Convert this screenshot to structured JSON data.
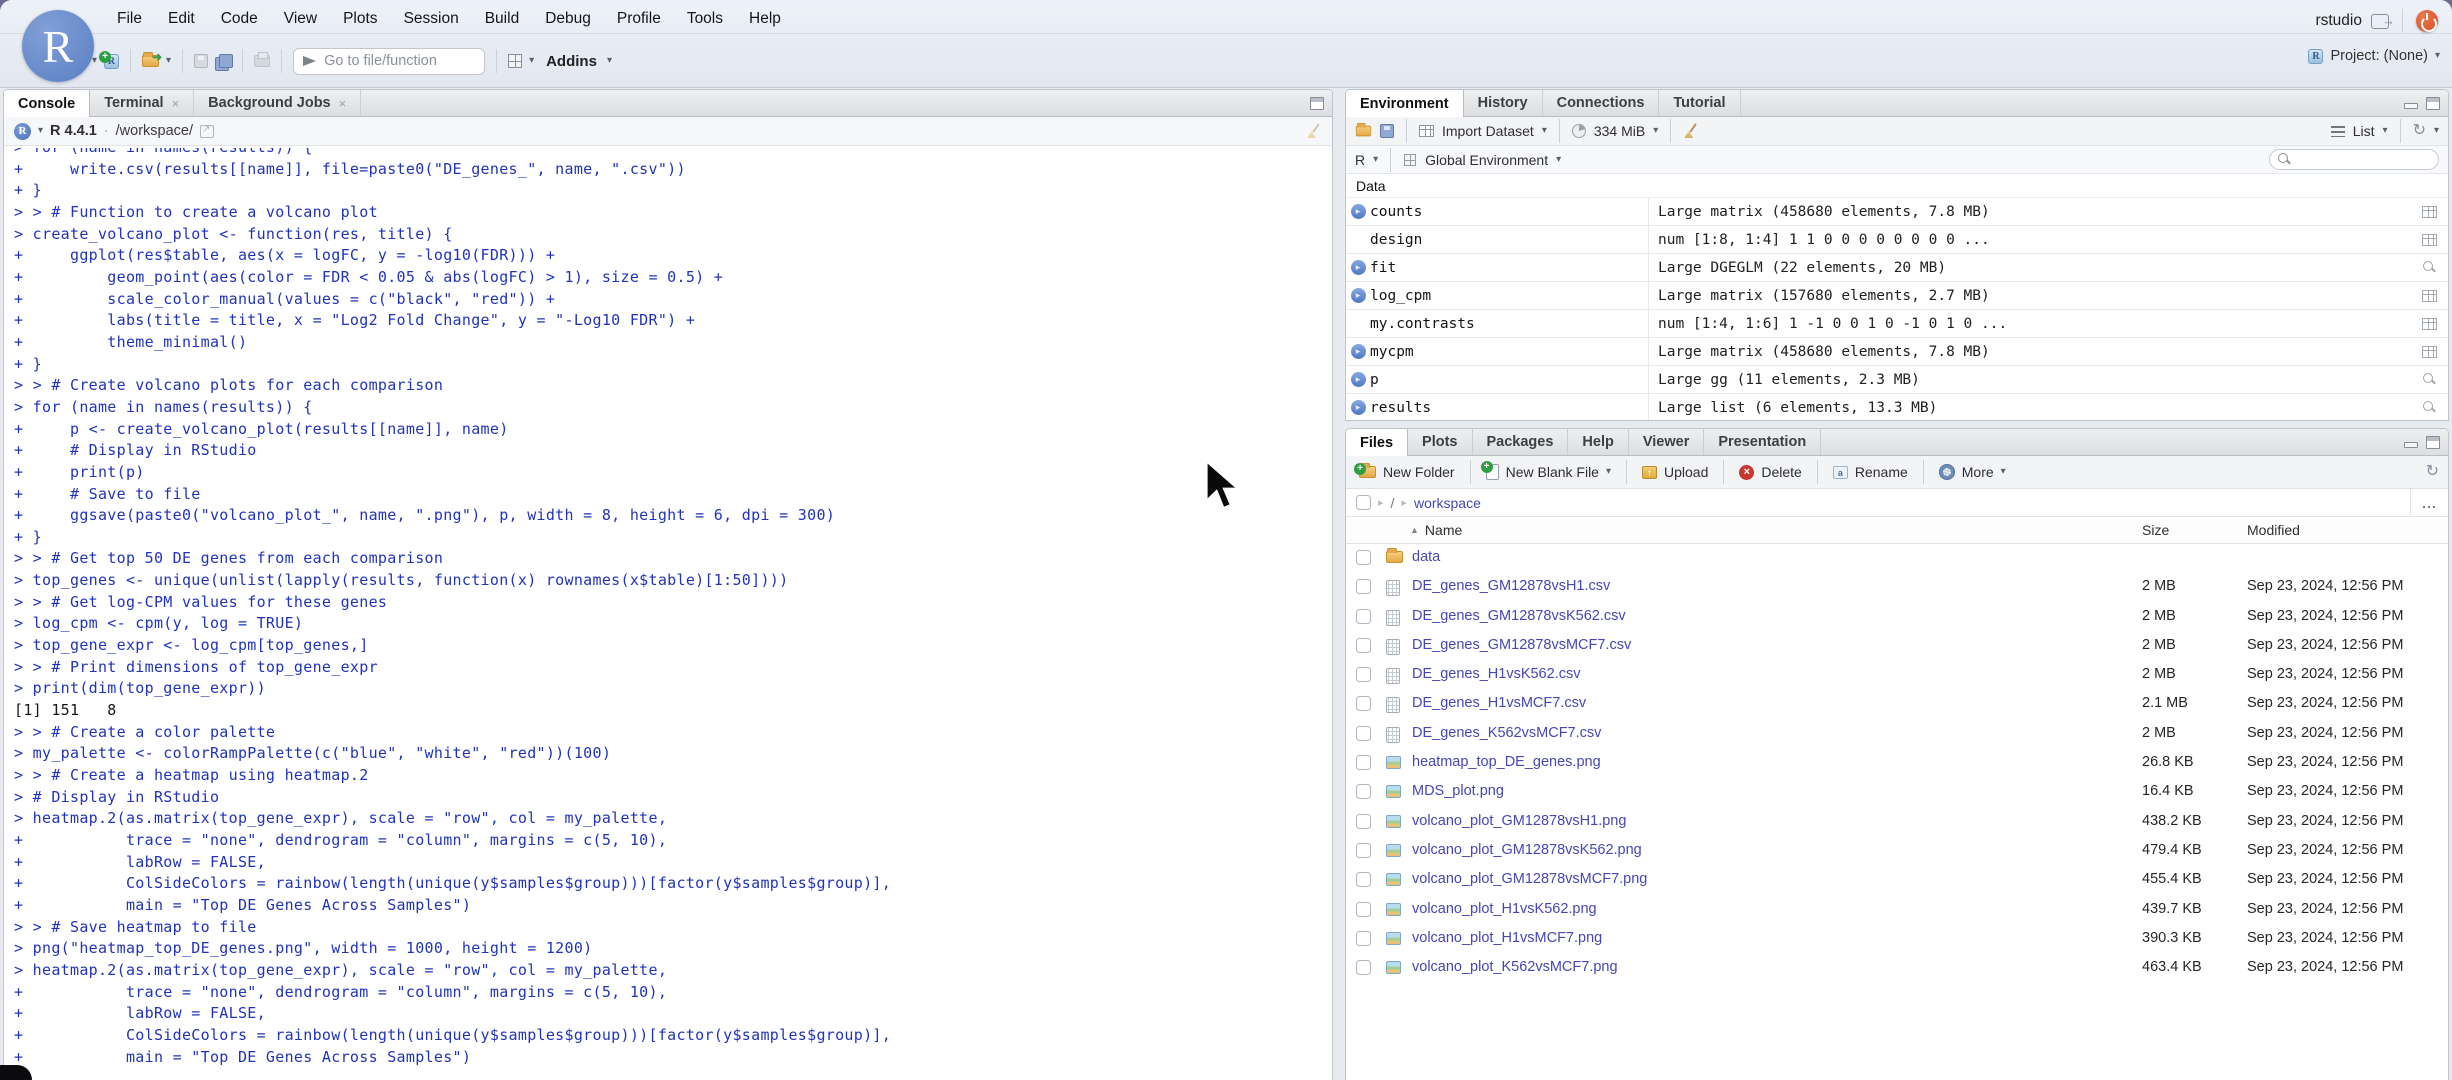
{
  "window": {
    "app_initial": "R",
    "session_user": "rstudio",
    "project_label": "Project: (None)"
  },
  "menubar": [
    "File",
    "Edit",
    "Code",
    "View",
    "Plots",
    "Session",
    "Build",
    "Debug",
    "Profile",
    "Tools",
    "Help"
  ],
  "toolbar": {
    "goto_placeholder": "Go to file/function",
    "addins_label": "Addins"
  },
  "console_pane": {
    "tabs": [
      {
        "label": "Console",
        "active": true,
        "closable": false
      },
      {
        "label": "Terminal",
        "active": false,
        "closable": true
      },
      {
        "label": "Background Jobs",
        "active": false,
        "closable": true
      }
    ],
    "r_version": "R 4.4.1",
    "separator": "·",
    "working_dir": "/workspace/",
    "lines": [
      {
        "type": "input",
        "text": "> for (name in names(results)) {"
      },
      {
        "type": "input",
        "text": "+     write.csv(results[[name]], file=paste0(\"DE_genes_\", name, \".csv\"))"
      },
      {
        "type": "input",
        "text": "+ }"
      },
      {
        "type": "input",
        "text": "> > # Function to create a volcano plot"
      },
      {
        "type": "input",
        "text": "> create_volcano_plot <- function(res, title) {"
      },
      {
        "type": "input",
        "text": "+     ggplot(res$table, aes(x = logFC, y = -log10(FDR))) +"
      },
      {
        "type": "input",
        "text": "+         geom_point(aes(color = FDR < 0.05 & abs(logFC) > 1), size = 0.5) +"
      },
      {
        "type": "input",
        "text": "+         scale_color_manual(values = c(\"black\", \"red\")) +"
      },
      {
        "type": "input",
        "text": "+         labs(title = title, x = \"Log2 Fold Change\", y = \"-Log10 FDR\") +"
      },
      {
        "type": "input",
        "text": "+         theme_minimal()"
      },
      {
        "type": "input",
        "text": "+ }"
      },
      {
        "type": "input",
        "text": "> > # Create volcano plots for each comparison"
      },
      {
        "type": "input",
        "text": "> for (name in names(results)) {"
      },
      {
        "type": "input",
        "text": "+     p <- create_volcano_plot(results[[name]], name)"
      },
      {
        "type": "input",
        "text": "+     # Display in RStudio"
      },
      {
        "type": "input",
        "text": "+     print(p)"
      },
      {
        "type": "input",
        "text": "+     # Save to file"
      },
      {
        "type": "input",
        "text": "+     ggsave(paste0(\"volcano_plot_\", name, \".png\"), p, width = 8, height = 6, dpi = 300)"
      },
      {
        "type": "input",
        "text": "+ }"
      },
      {
        "type": "input",
        "text": "> > # Get top 50 DE genes from each comparison"
      },
      {
        "type": "input",
        "text": "> top_genes <- unique(unlist(lapply(results, function(x) rownames(x$table)[1:50])))"
      },
      {
        "type": "input",
        "text": "> > # Get log-CPM values for these genes"
      },
      {
        "type": "input",
        "text": "> log_cpm <- cpm(y, log = TRUE)"
      },
      {
        "type": "input",
        "text": "> top_gene_expr <- log_cpm[top_genes,]"
      },
      {
        "type": "input",
        "text": "> > # Print dimensions of top_gene_expr"
      },
      {
        "type": "input",
        "text": "> print(dim(top_gene_expr))"
      },
      {
        "type": "output",
        "text": "[1] 151   8"
      },
      {
        "type": "input",
        "text": "> > # Create a color palette"
      },
      {
        "type": "input",
        "text": "> my_palette <- colorRampPalette(c(\"blue\", \"white\", \"red\"))(100)"
      },
      {
        "type": "input",
        "text": "> > # Create a heatmap using heatmap.2"
      },
      {
        "type": "input",
        "text": "> # Display in RStudio"
      },
      {
        "type": "input",
        "text": "> heatmap.2(as.matrix(top_gene_expr), scale = \"row\", col = my_palette,"
      },
      {
        "type": "input",
        "text": "+           trace = \"none\", dendrogram = \"column\", margins = c(5, 10),"
      },
      {
        "type": "input",
        "text": "+           labRow = FALSE,"
      },
      {
        "type": "input",
        "text": "+           ColSideColors = rainbow(length(unique(y$samples$group)))[factor(y$samples$group)],"
      },
      {
        "type": "input",
        "text": "+           main = \"Top DE Genes Across Samples\")"
      },
      {
        "type": "input",
        "text": "> > # Save heatmap to file"
      },
      {
        "type": "input",
        "text": "> png(\"heatmap_top_DE_genes.png\", width = 1000, height = 1200)"
      },
      {
        "type": "input",
        "text": "> heatmap.2(as.matrix(top_gene_expr), scale = \"row\", col = my_palette,"
      },
      {
        "type": "input",
        "text": "+           trace = \"none\", dendrogram = \"column\", margins = c(5, 10),"
      },
      {
        "type": "input",
        "text": "+           labRow = FALSE,"
      },
      {
        "type": "input",
        "text": "+           ColSideColors = rainbow(length(unique(y$samples$group)))[factor(y$samples$group)],"
      },
      {
        "type": "input",
        "text": "+           main = \"Top DE Genes Across Samples\")"
      }
    ]
  },
  "environment_pane": {
    "tabs": [
      {
        "label": "Environment",
        "active": true
      },
      {
        "label": "History",
        "active": false
      },
      {
        "label": "Connections",
        "active": false
      },
      {
        "label": "Tutorial",
        "active": false
      }
    ],
    "toolbar": {
      "import_label": "Import Dataset",
      "memory_label": "334 MiB",
      "list_label": "List"
    },
    "scope": {
      "language": "R",
      "environment": "Global Environment"
    },
    "section_label": "Data",
    "rows": [
      {
        "name": "counts",
        "value": "Large matrix (458680 elements,  7.8 MB)",
        "expandable": true,
        "action": "table"
      },
      {
        "name": "design",
        "value": "num [1:8, 1:4] 1 1 0 0 0 0 0 0 0 0 ...",
        "expandable": false,
        "action": "table"
      },
      {
        "name": "fit",
        "value": "Large DGEGLM (22 elements,  20 MB)",
        "expandable": true,
        "action": "magnifier"
      },
      {
        "name": "log_cpm",
        "value": "Large matrix (157680 elements,  2.7 MB)",
        "expandable": true,
        "action": "table"
      },
      {
        "name": "my.contrasts",
        "value": "num [1:4, 1:6] 1 -1 0 0 1 0 -1 0 1 0 ...",
        "expandable": false,
        "action": "table"
      },
      {
        "name": "mycpm",
        "value": "Large matrix (458680 elements,  7.8 MB)",
        "expandable": true,
        "action": "table"
      },
      {
        "name": "p",
        "value": "Large gg (11 elements,  2.3 MB)",
        "expandable": true,
        "action": "magnifier"
      },
      {
        "name": "results",
        "value": "Large list (6 elements,  13.3 MB)",
        "expandable": true,
        "action": "magnifier"
      }
    ]
  },
  "files_pane": {
    "tabs": [
      {
        "label": "Files",
        "active": true
      },
      {
        "label": "Plots",
        "active": false
      },
      {
        "label": "Packages",
        "active": false
      },
      {
        "label": "Help",
        "active": false
      },
      {
        "label": "Viewer",
        "active": false
      },
      {
        "label": "Presentation",
        "active": false
      }
    ],
    "toolbar": [
      {
        "label": "New Folder",
        "icon": "new-folder",
        "caret": false
      },
      {
        "label": "New Blank File",
        "icon": "new-file",
        "caret": true
      },
      {
        "label": "Upload",
        "icon": "upload",
        "caret": false
      },
      {
        "label": "Delete",
        "icon": "delete",
        "caret": false
      },
      {
        "label": "Rename",
        "icon": "rename",
        "caret": false
      },
      {
        "label": "More",
        "icon": "gear",
        "caret": true
      }
    ],
    "breadcrumb": {
      "root": "/",
      "current": "workspace",
      "ellipsis": "..."
    },
    "columns": {
      "name": "Name",
      "size": "Size",
      "modified": "Modified"
    },
    "files": [
      {
        "name": "data",
        "type": "folder",
        "size": "",
        "modified": ""
      },
      {
        "name": "DE_genes_GM12878vsH1.csv",
        "type": "csv",
        "size": "2 MB",
        "modified": "Sep 23, 2024, 12:56 PM"
      },
      {
        "name": "DE_genes_GM12878vsK562.csv",
        "type": "csv",
        "size": "2 MB",
        "modified": "Sep 23, 2024, 12:56 PM"
      },
      {
        "name": "DE_genes_GM12878vsMCF7.csv",
        "type": "csv",
        "size": "2 MB",
        "modified": "Sep 23, 2024, 12:56 PM"
      },
      {
        "name": "DE_genes_H1vsK562.csv",
        "type": "csv",
        "size": "2 MB",
        "modified": "Sep 23, 2024, 12:56 PM"
      },
      {
        "name": "DE_genes_H1vsMCF7.csv",
        "type": "csv",
        "size": "2.1 MB",
        "modified": "Sep 23, 2024, 12:56 PM"
      },
      {
        "name": "DE_genes_K562vsMCF7.csv",
        "type": "csv",
        "size": "2 MB",
        "modified": "Sep 23, 2024, 12:56 PM"
      },
      {
        "name": "heatmap_top_DE_genes.png",
        "type": "png",
        "size": "26.8 KB",
        "modified": "Sep 23, 2024, 12:56 PM"
      },
      {
        "name": "MDS_plot.png",
        "type": "png",
        "size": "16.4 KB",
        "modified": "Sep 23, 2024, 12:56 PM"
      },
      {
        "name": "volcano_plot_GM12878vsH1.png",
        "type": "png",
        "size": "438.2 KB",
        "modified": "Sep 23, 2024, 12:56 PM"
      },
      {
        "name": "volcano_plot_GM12878vsK562.png",
        "type": "png",
        "size": "479.4 KB",
        "modified": "Sep 23, 2024, 12:56 PM"
      },
      {
        "name": "volcano_plot_GM12878vsMCF7.png",
        "type": "png",
        "size": "455.4 KB",
        "modified": "Sep 23, 2024, 12:56 PM"
      },
      {
        "name": "volcano_plot_H1vsK562.png",
        "type": "png",
        "size": "439.7 KB",
        "modified": "Sep 23, 2024, 12:56 PM"
      },
      {
        "name": "volcano_plot_H1vsMCF7.png",
        "type": "png",
        "size": "390.3 KB",
        "modified": "Sep 23, 2024, 12:56 PM"
      },
      {
        "name": "volcano_plot_K562vsMCF7.png",
        "type": "png",
        "size": "463.4 KB",
        "modified": "Sep 23, 2024, 12:56 PM"
      }
    ]
  },
  "colors": {
    "accent_link": "#4646b5",
    "console_input": "#2133bd",
    "expander_blue": "#4d78c8",
    "power_orange": "#d94f2b"
  }
}
